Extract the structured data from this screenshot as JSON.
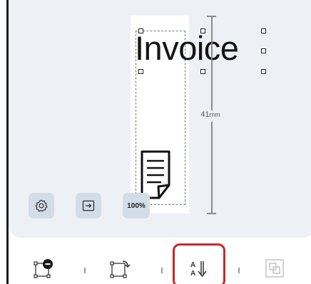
{
  "canvas": {
    "element_text": "Invoice",
    "dimension": {
      "value": "41",
      "unit": "mm"
    }
  },
  "canvas_tools": {
    "settings_icon": "gear-icon",
    "export_icon": "export-icon",
    "zoom_label": "100%"
  },
  "bottom_toolbar": {
    "items": [
      {
        "icon": "delete-element-icon"
      },
      {
        "icon": "rotate-element-icon"
      },
      {
        "icon": "text-sort-icon",
        "highlighted": true
      },
      {
        "icon": "layer-arrange-icon",
        "disabled": true
      }
    ]
  },
  "colors": {
    "canvas_background": "#edf0f4",
    "tool_button_background": "#d3dde7",
    "highlight_border": "#c62a2a"
  }
}
